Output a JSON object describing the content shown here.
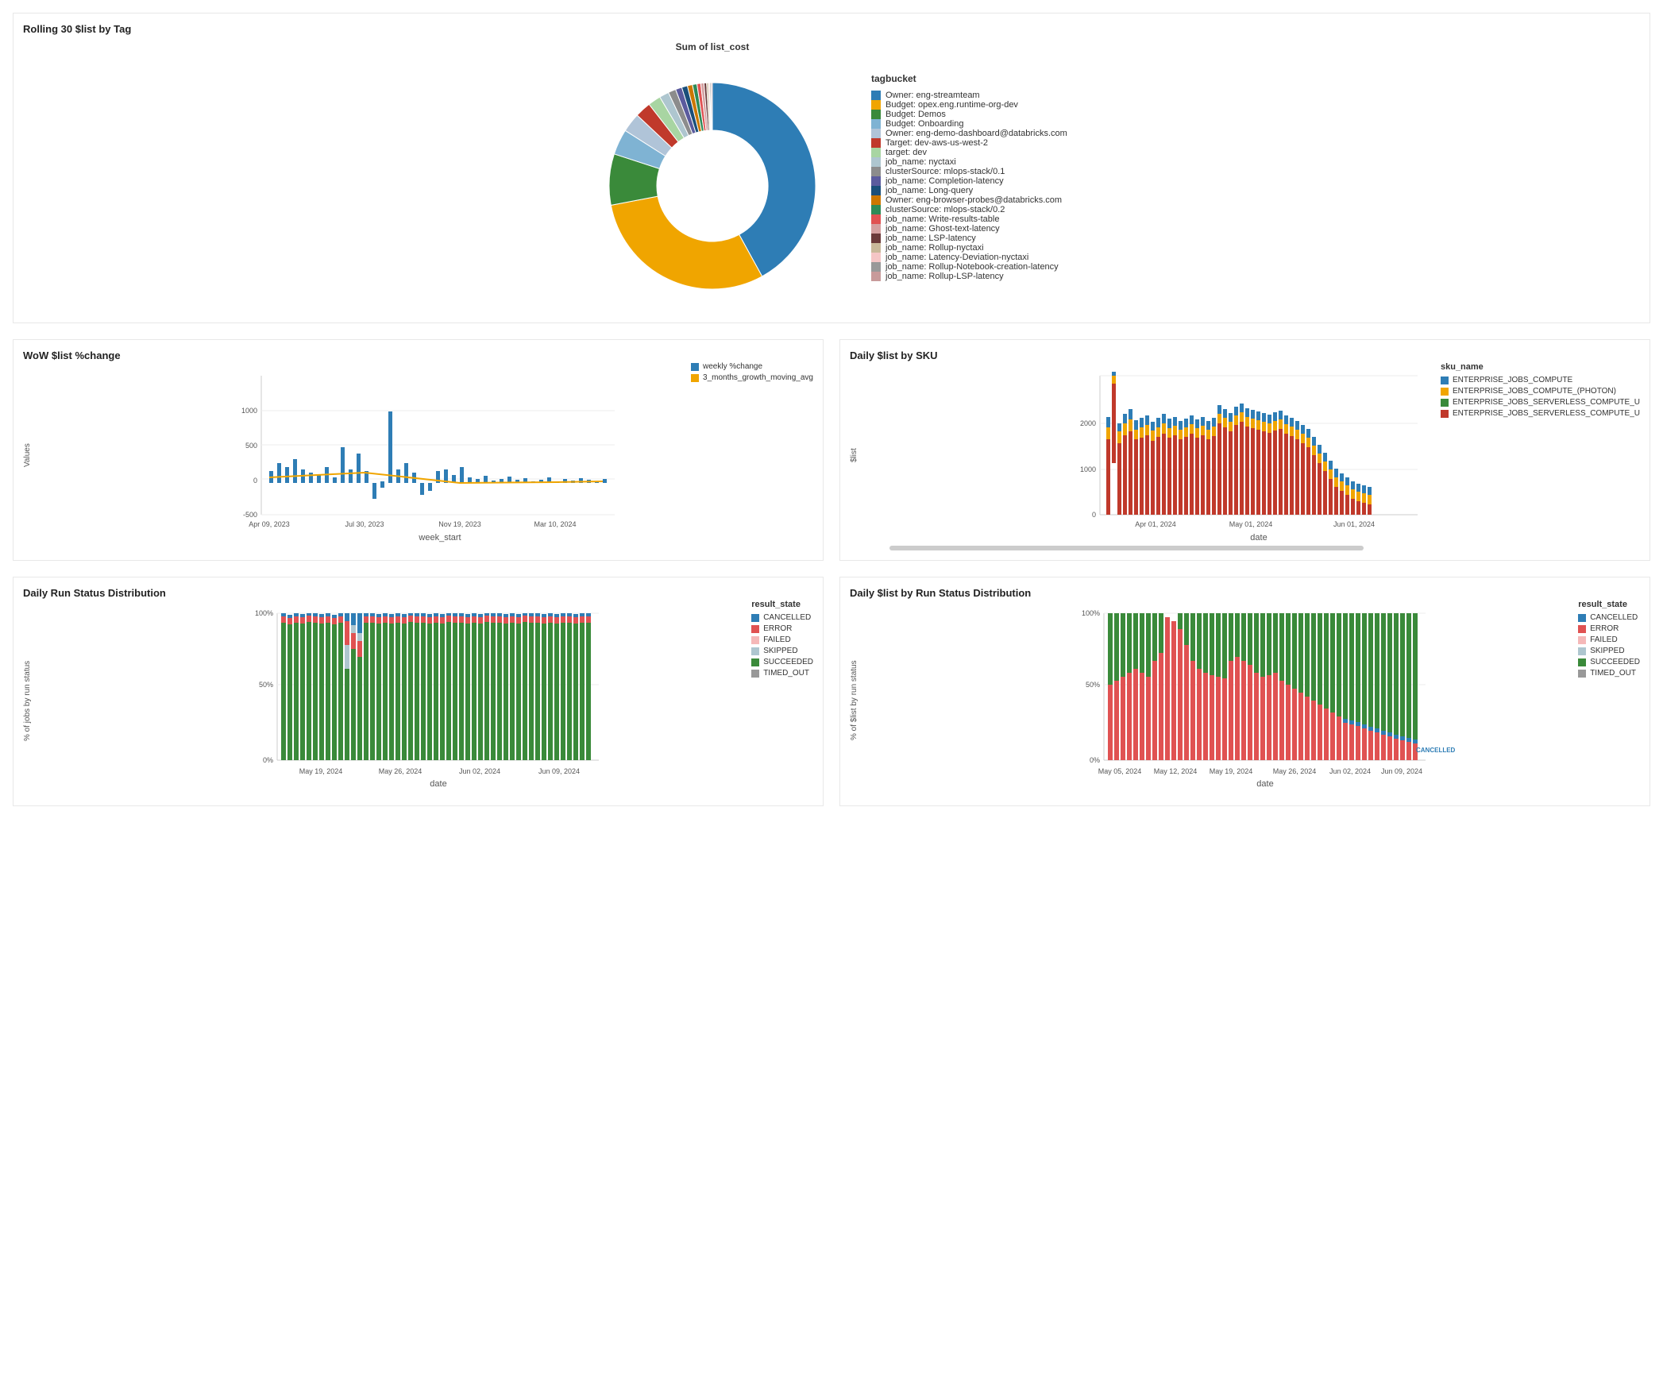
{
  "topSection": {
    "title": "Rolling 30 $list by Tag",
    "chartTitle": "Sum of list_cost",
    "legendTitle": "tagbucket",
    "legendItems": [
      {
        "label": "Owner: eng-streamteam",
        "color": "#2e7db5"
      },
      {
        "label": "Budget: opex.eng.runtime-org-dev",
        "color": "#f0a500"
      },
      {
        "label": "Budget: Demos",
        "color": "#3a8a3a"
      },
      {
        "label": "Budget: Onboarding",
        "color": "#7fb3d3"
      },
      {
        "label": "Owner: eng-demo-dashboard@databricks.com",
        "color": "#b0c4d8"
      },
      {
        "label": "Target: dev-aws-us-west-2",
        "color": "#c0392b"
      },
      {
        "label": "target: dev",
        "color": "#a8d5a2"
      },
      {
        "label": "job_name: nyctaxi",
        "color": "#aec6cf"
      },
      {
        "label": "clusterSource: mlops-stack/0.1",
        "color": "#8c8c8c"
      },
      {
        "label": "job_name: Completion-latency",
        "color": "#5b5b9e"
      },
      {
        "label": "job_name: Long-query",
        "color": "#1a4f7a"
      },
      {
        "label": "Owner: eng-browser-probes@databricks.com",
        "color": "#cc7700"
      },
      {
        "label": "clusterSource: mlops-stack/0.2",
        "color": "#2e8b57"
      },
      {
        "label": "job_name: Write-results-table",
        "color": "#e05252"
      },
      {
        "label": "job_name: Ghost-text-latency",
        "color": "#d4a0a0"
      },
      {
        "label": "job_name: LSP-latency",
        "color": "#6b3a3a"
      },
      {
        "label": "job_name: Rollup-nyctaxi",
        "color": "#c9b99a"
      },
      {
        "label": "job_name: Latency-Deviation-nyctaxi",
        "color": "#f5c6c6"
      },
      {
        "label": "job_name: Rollup-Notebook-creation-latency",
        "color": "#999"
      },
      {
        "label": "job_name: Rollup-LSP-latency",
        "color": "#c89a9a"
      }
    ],
    "donutSegments": [
      {
        "color": "#2e7db5",
        "pct": 0.42
      },
      {
        "color": "#f0a500",
        "pct": 0.3
      },
      {
        "color": "#3a8a3a",
        "pct": 0.08
      },
      {
        "color": "#7fb3d3",
        "pct": 0.04
      },
      {
        "color": "#b0c4d8",
        "pct": 0.03
      },
      {
        "color": "#c0392b",
        "pct": 0.025
      },
      {
        "color": "#a8d5a2",
        "pct": 0.02
      },
      {
        "color": "#aec6cf",
        "pct": 0.015
      },
      {
        "color": "#8c8c8c",
        "pct": 0.012
      },
      {
        "color": "#5b5b9e",
        "pct": 0.01
      },
      {
        "color": "#1a4f7a",
        "pct": 0.009
      },
      {
        "color": "#cc7700",
        "pct": 0.008
      },
      {
        "color": "#2e8b57",
        "pct": 0.007
      },
      {
        "color": "#e05252",
        "pct": 0.006
      },
      {
        "color": "#d4a0a0",
        "pct": 0.005
      },
      {
        "color": "#6b3a3a",
        "pct": 0.004
      },
      {
        "color": "#c9b99a",
        "pct": 0.003
      },
      {
        "color": "#f5c6c6",
        "pct": 0.002
      },
      {
        "color": "#999",
        "pct": 0.002
      },
      {
        "color": "#c89a9a",
        "pct": 0.002
      }
    ]
  },
  "wowSection": {
    "title": "WoW $list %change",
    "legend": [
      {
        "label": "weekly %change",
        "color": "#2e7db5"
      },
      {
        "label": "3_months_growth_moving_avg",
        "color": "#f0a500"
      }
    ],
    "xLabel": "week_start",
    "yLabel": "Values",
    "xTicks": [
      "Apr 09, 2023",
      "Jul 30, 2023",
      "Nov 19, 2023",
      "Mar 10, 2024"
    ],
    "yTicks": [
      "-500",
      "0",
      "500",
      "1000"
    ]
  },
  "dailySkuSection": {
    "title": "Daily $list by SKU",
    "legendTitle": "sku_name",
    "legend": [
      {
        "label": "ENTERPRISE_JOBS_COMPUTE",
        "color": "#2e7db5"
      },
      {
        "label": "ENTERPRISE_JOBS_COMPUTE_(PHOTON)",
        "color": "#f0a500"
      },
      {
        "label": "ENTERPRISE_JOBS_SERVERLESS_COMPUTE_U",
        "color": "#3a8a3a"
      },
      {
        "label": "ENTERPRISE_JOBS_SERVERLESS_COMPUTE_U",
        "color": "#c0392b"
      }
    ],
    "xLabel": "date",
    "yLabel": "$list",
    "xTicks": [
      "Apr 01, 2024",
      "May 01, 2024",
      "Jun 01, 2024"
    ],
    "yTicks": [
      "0",
      "1000",
      "2000"
    ]
  },
  "dailyRunStatusSection": {
    "title": "Daily Run Status Distribution",
    "legendTitle": "result_state",
    "legend": [
      {
        "label": "CANCELLED",
        "color": "#2e7db5"
      },
      {
        "label": "ERROR",
        "color": "#e05252"
      },
      {
        "label": "FAILED",
        "color": "#f5b8b8"
      },
      {
        "label": "SKIPPED",
        "color": "#aec6cf"
      },
      {
        "label": "SUCCEEDED",
        "color": "#3a8a3a"
      },
      {
        "label": "TIMED_OUT",
        "color": "#999"
      }
    ],
    "xLabel": "date",
    "yLabel": "% of jobs by run status",
    "xTicks": [
      "May 19, 2024",
      "May 26, 2024",
      "Jun 02, 2024",
      "Jun 09, 2024"
    ],
    "yTicks": [
      "0%",
      "50%",
      "100%"
    ]
  },
  "dailyListStatusSection": {
    "title": "Daily $list by Run Status Distribution",
    "legendTitle": "result_state",
    "legend": [
      {
        "label": "CANCELLED",
        "color": "#2e7db5"
      },
      {
        "label": "ERROR",
        "color": "#e05252"
      },
      {
        "label": "FAILED",
        "color": "#f5b8b8"
      },
      {
        "label": "SKIPPED",
        "color": "#aec6cf"
      },
      {
        "label": "SUCCEEDED",
        "color": "#3a8a3a"
      },
      {
        "label": "TIMED_OUT",
        "color": "#999"
      }
    ],
    "xLabel": "date",
    "yLabel": "% of $list by run status",
    "xTicks": [
      "May 05, 2024",
      "May 12, 2024",
      "May 19, 2024",
      "May 26, 2024",
      "Jun 02, 2024",
      "Jun 09, 2024"
    ],
    "yTicks": [
      "0%",
      "50%",
      "100%"
    ]
  }
}
